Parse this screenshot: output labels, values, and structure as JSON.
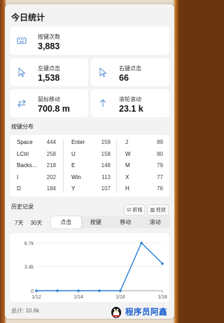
{
  "title": "今日统计",
  "stats": {
    "keypress": {
      "label": "按键次数",
      "value": "3,883"
    },
    "left_click": {
      "label": "左键点击",
      "value": "1,538"
    },
    "right_click": {
      "label": "右键点击",
      "value": "66"
    },
    "mouse_move": {
      "label": "鼠标移动",
      "value": "700.8 m"
    },
    "scroll": {
      "label": "滚轮滚动",
      "value": "23.1 k"
    }
  },
  "key_distribution": {
    "title": "按键分布",
    "rows": [
      [
        [
          "Space",
          "444"
        ],
        [
          "Enter",
          "159"
        ],
        [
          "J",
          "89"
        ]
      ],
      [
        [
          "LCtrl",
          "258"
        ],
        [
          "U",
          "158"
        ],
        [
          "W",
          "80"
        ]
      ],
      [
        [
          "Backs...",
          "218"
        ],
        [
          "E",
          "148"
        ],
        [
          "M",
          "79"
        ]
      ],
      [
        [
          "I",
          "202"
        ],
        [
          "Win",
          "113"
        ],
        [
          "X",
          "77"
        ]
      ],
      [
        [
          "D",
          "184"
        ],
        [
          "Y",
          "107"
        ],
        [
          "H",
          "76"
        ]
      ]
    ]
  },
  "history": {
    "title": "历史记录",
    "line_toggle": "折线",
    "bar_toggle": "柱状",
    "range_7": "7天",
    "range_30": "30天",
    "tabs": [
      "点击",
      "按键",
      "移动",
      "滚动"
    ],
    "active_tab": "点击"
  },
  "chart_data": {
    "type": "line",
    "x": [
      "1/12",
      "1/13",
      "1/14",
      "1/15",
      "1/16",
      "1/17",
      "1/18"
    ],
    "x_tick_labels": [
      "1/12",
      "1/14",
      "1/16",
      "1/18"
    ],
    "y_tick_labels": [
      "0",
      "3.4k",
      "6.7k"
    ],
    "series": [
      {
        "values": [
          0,
          0,
          0,
          0,
          0,
          6700,
          3800
        ]
      }
    ],
    "ylim": [
      0,
      6700
    ],
    "color": "#2b7fd8"
  },
  "total": "总计: 10.6k",
  "watermark": "程序员阿鑫"
}
